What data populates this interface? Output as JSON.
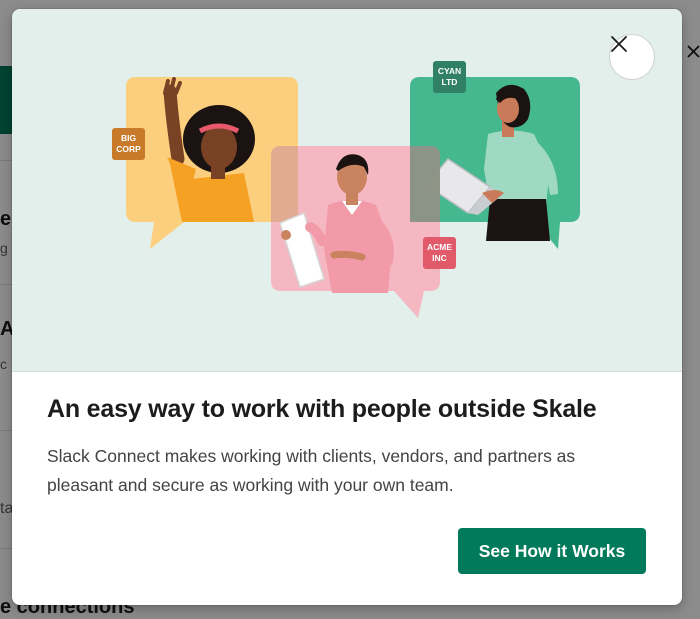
{
  "modal": {
    "headline": "An easy way to work with people outside Skale",
    "description": "Slack Connect makes working with clients, vendors, and partners as pleasant and secure as working with your own team.",
    "cta_label": "See How it Works",
    "close_icon": "close-icon"
  },
  "illustration": {
    "tags": [
      {
        "line1": "BIG",
        "line2": "CORP",
        "color": "#c8792a"
      },
      {
        "line1": "CYAN",
        "line2": "LTD",
        "color": "#2f8064"
      },
      {
        "line1": "ACME",
        "line2": "INC",
        "color": "#e05a6a"
      }
    ]
  },
  "background": {
    "frag1": "e",
    "frag2": "g",
    "frag3": "A",
    "frag4": "c",
    "frag5": "ta",
    "bottom_text": "e connections"
  },
  "colors": {
    "accent": "#007a5a",
    "hero_bg": "#e3efea",
    "yellow_bubble": "#fbcf7e",
    "green_bubble": "#45b88f",
    "pink_bubble": "#f5b3c0"
  }
}
